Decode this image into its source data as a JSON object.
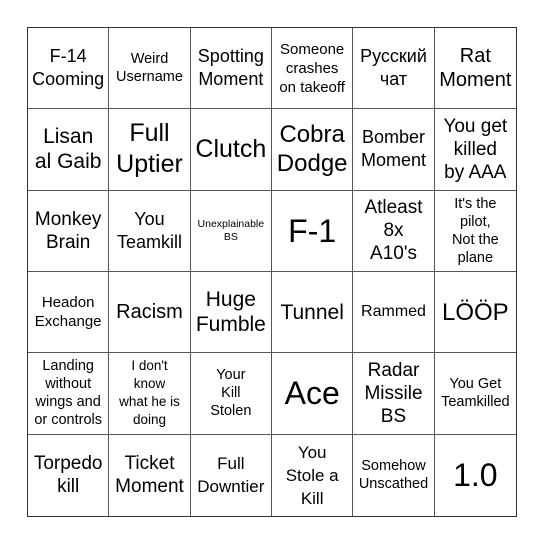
{
  "bingo_card": {
    "cells": [
      {
        "text": "F-14\nCooming"
      },
      {
        "text": "Weird\nUsername"
      },
      {
        "text": "Spotting\nMoment"
      },
      {
        "text": "Someone\ncrashes\non takeoff"
      },
      {
        "text": "Русский\nчат"
      },
      {
        "text": "Rat\nMoment"
      },
      {
        "text": "Lisan\nal Gaib"
      },
      {
        "text": "Full\nUptier"
      },
      {
        "text": "Clutch"
      },
      {
        "text": "Cobra\nDodge"
      },
      {
        "text": "Bomber\nMoment"
      },
      {
        "text": "You get\nkilled\nby AAA"
      },
      {
        "text": "Monkey\nBrain"
      },
      {
        "text": "You\nTeamkill"
      },
      {
        "text": "Unexplainable\nBS"
      },
      {
        "text": "F-1"
      },
      {
        "text": "Atleast\n8x\nA10's"
      },
      {
        "text": "It's the\npilot,\nNot the\nplane"
      },
      {
        "text": "Headon\nExchange"
      },
      {
        "text": "Racism"
      },
      {
        "text": "Huge\nFumble"
      },
      {
        "text": "Tunnel"
      },
      {
        "text": "Rammed"
      },
      {
        "text": "LÖÖP"
      },
      {
        "text": "Landing\nwithout\nwings and\nor controls"
      },
      {
        "text": "I don't\nknow\nwhat he is\ndoing"
      },
      {
        "text": "Your\nKill\nStolen"
      },
      {
        "text": "Ace"
      },
      {
        "text": "Radar\nMissile\nBS"
      },
      {
        "text": "You Get\nTeamkilled"
      },
      {
        "text": "Torpedo\nkill"
      },
      {
        "text": "Ticket\nMoment"
      },
      {
        "text": "Full\nDowntier"
      },
      {
        "text": "You\nStole a\nKill"
      },
      {
        "text": "Somehow\nUnscathed"
      },
      {
        "text": "1.0"
      }
    ]
  }
}
